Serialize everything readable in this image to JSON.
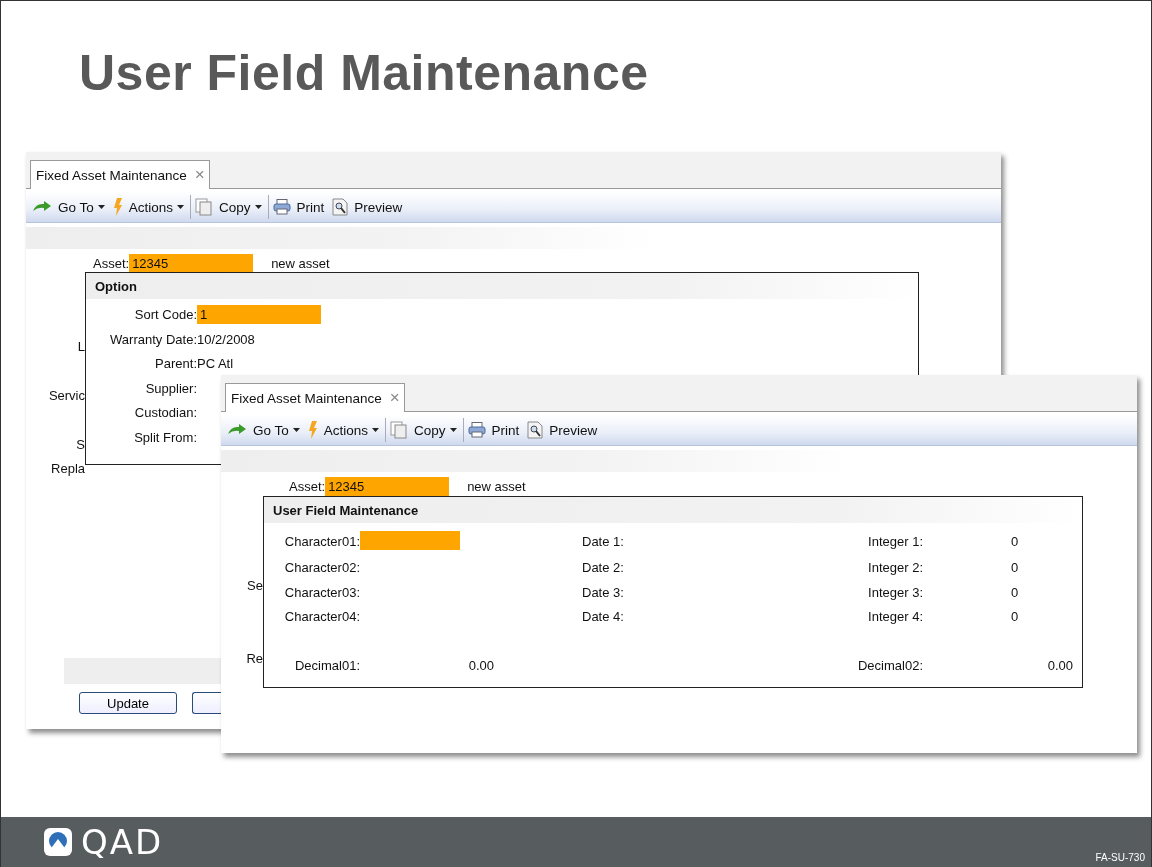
{
  "slide": {
    "title": "User Field Maintenance",
    "logo_text": "QAD",
    "footer_code": "FA-SU-730"
  },
  "back_window": {
    "tab": {
      "label": "Fixed Asset Maintenance",
      "close": "×"
    },
    "toolbar": [
      {
        "kind": "goto",
        "label": "Go To",
        "dropdown": true,
        "separated": false
      },
      {
        "kind": "actions",
        "label": "Actions",
        "dropdown": true,
        "separated": false
      },
      {
        "kind": "copy",
        "label": "Copy",
        "dropdown": true,
        "separated": true
      },
      {
        "kind": "print",
        "label": "Print",
        "dropdown": false,
        "separated": true
      },
      {
        "kind": "preview",
        "label": "Preview",
        "dropdown": false,
        "separated": false
      }
    ],
    "asset": {
      "label": "Asset:",
      "value": "12345",
      "description": "new asset"
    },
    "partial_labels": [
      "L",
      "Servic",
      "S",
      "Repla"
    ],
    "buttons": [
      "Update"
    ],
    "option": {
      "title": "Option",
      "fields": [
        {
          "label": "Sort Code:",
          "value": "1",
          "highlighted": true
        },
        {
          "label": "Warranty Date:",
          "value": "10/2/2008",
          "highlighted": false
        },
        {
          "label": "Parent:",
          "value": "PC Atl",
          "highlighted": false
        },
        {
          "label": "Supplier:",
          "highlighted": false
        },
        {
          "label": "Custodian:",
          "highlighted": false
        },
        {
          "label": "Split From:",
          "highlighted": false
        }
      ]
    }
  },
  "front_window": {
    "tab": {
      "label": "Fixed Asset Maintenance",
      "close": "×"
    },
    "toolbar": [
      {
        "kind": "goto",
        "label": "Go To",
        "dropdown": true,
        "separated": false
      },
      {
        "kind": "actions",
        "label": "Actions",
        "dropdown": true,
        "separated": false
      },
      {
        "kind": "copy",
        "label": "Copy",
        "dropdown": true,
        "separated": true
      },
      {
        "kind": "print",
        "label": "Print",
        "dropdown": false,
        "separated": true
      },
      {
        "kind": "preview",
        "label": "Preview",
        "dropdown": false,
        "separated": false
      }
    ],
    "asset": {
      "label": "Asset:",
      "value": "12345",
      "description": "new asset"
    },
    "partial_labels": [
      "Se",
      "Re"
    ],
    "user_fields": {
      "title": "User Field Maintenance",
      "rows": [
        {
          "character_label": "Character01:",
          "character_highlighted": true,
          "date_label": "Date 1:",
          "integer_label": "Integer 1:",
          "integer_value": "0"
        },
        {
          "character_label": "Character02:",
          "character_highlighted": false,
          "date_label": "Date 2:",
          "integer_label": "Integer 2:",
          "integer_value": "0"
        },
        {
          "character_label": "Character03:",
          "character_highlighted": false,
          "date_label": "Date 3:",
          "integer_label": "Integer 3:",
          "integer_value": "0"
        },
        {
          "character_label": "Character04:",
          "character_highlighted": false,
          "date_label": "Date 4:",
          "integer_label": "Integer 4:",
          "integer_value": "0"
        }
      ],
      "decimals": [
        {
          "label": "Decimal01:",
          "value": "0.00"
        },
        {
          "label": "Decimal02:",
          "value": "0.00"
        }
      ]
    }
  }
}
